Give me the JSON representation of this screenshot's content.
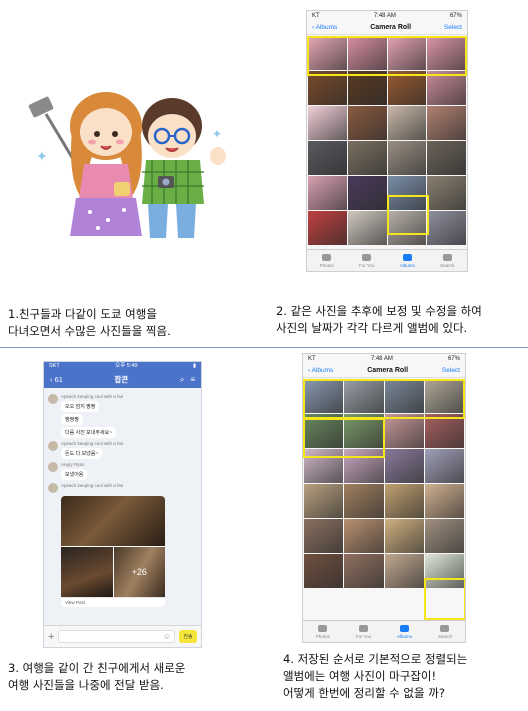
{
  "captions": {
    "p1": "1.친구들과 다같이 도쿄 여행을\n다녀오면서 수많은 사진들을 찍음.",
    "p2": "2. 같은 사진을 추후에 보정 및 수정을 하여\n사진의 날짜가 각각 다르게 앨범에 있다.",
    "p3": "3. 여행을 같이 간 친구에게서 새로운\n여행 사진들을 나중에 전달 받음.",
    "p4": "4. 저장된 순서로 기본적으로 정렬되는\n앨범에는 여행 사진이 마구잡이!\n어떻게 한번에 정리할 수 없을 까?"
  },
  "phone_top": {
    "carrier": "KT",
    "time": "7:48 AM",
    "battery": "67%",
    "back": "Albums",
    "title": "Camera Roll",
    "select": "Select",
    "tabs": [
      "Photos",
      "For You",
      "Albums",
      "Search"
    ],
    "active_tab": "Albums",
    "cells": [
      "#e9a8b6",
      "#d98fa0",
      "#e5a3b2",
      "#dc96a8",
      "#7a4a2a",
      "#5a3a22",
      "#9a5a30",
      "#c98a98",
      "#f2d0d8",
      "#8a5a40",
      "#c9b8a8",
      "#b08070",
      "#5a5a60",
      "#7a7060",
      "#9a8e82",
      "#6a6258",
      "#d8a0b0",
      "#4a3a5a",
      "#7a8ea8",
      "#8a8070",
      "#c04040",
      "#d0c8c0",
      "#b8b0a8",
      "#9090a0"
    ],
    "highlight_color": "#f5e61c"
  },
  "phone_bottom": {
    "carrier": "KT",
    "time": "7:48 AM",
    "battery": "67%",
    "back": "Albums",
    "title": "Camera Roll",
    "select": "Select",
    "tabs": [
      "Photos",
      "For You",
      "Albums",
      "Search"
    ],
    "active_tab": "Albums",
    "cells": [
      "#8a9ab0",
      "#9aa0a8",
      "#7a8898",
      "#b0a898",
      "#6a8a60",
      "#7a9a6a",
      "#c89898",
      "#a86060",
      "#d0b8c8",
      "#c8a8c0",
      "#8a7a9a",
      "#a0a0b8",
      "#b8a080",
      "#a08060",
      "#c0a070",
      "#d0b090",
      "#8a7060",
      "#b89070",
      "#d0b080",
      "#a09080",
      "#705040",
      "#907060",
      "#c0a890",
      "#e0e8d8"
    ],
    "highlight_color": "#f5e61c"
  },
  "chat": {
    "carrier": "SKT",
    "time": "오후 5:49",
    "back": "61",
    "room": "팝콘",
    "messages": [
      {
        "sender": "Apeach keeping cool with a fan",
        "lines": [
          "오오 엄지 짱짱",
          "짱짱짱",
          "다음 사진 보내주세요~"
        ]
      },
      {
        "sender": "Apeach keeping cool with a fan",
        "lines": [
          "돈도 다 보냈음~"
        ]
      },
      {
        "sender": "Angry Ryan",
        "lines": [
          "보냈어용"
        ]
      },
      {
        "sender": "Apeach keeping cool with a fan",
        "lines": []
      }
    ],
    "photo_count": "+26",
    "view_post": "View Post",
    "send": "전송",
    "input_color": "#f6e63a"
  }
}
